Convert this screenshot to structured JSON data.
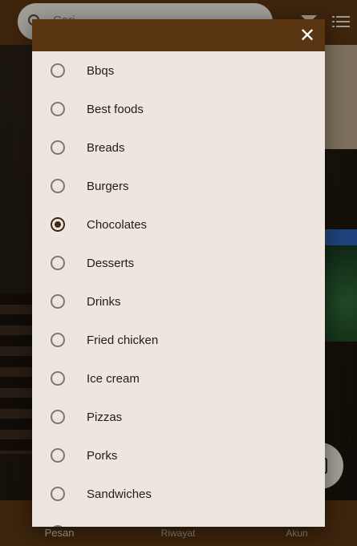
{
  "app": {
    "search": {
      "placeholder": "Cari..."
    },
    "bottom_nav": [
      {
        "label": "Pesan",
        "active": true
      },
      {
        "label": "Riwayat",
        "active": false
      },
      {
        "label": "Akun",
        "active": false
      }
    ]
  },
  "dialog": {
    "close_symbol": "✕",
    "selected": "Chocolates",
    "options": [
      {
        "label": "Bbqs",
        "checked": false
      },
      {
        "label": "Best foods",
        "checked": false
      },
      {
        "label": "Breads",
        "checked": false
      },
      {
        "label": "Burgers",
        "checked": false
      },
      {
        "label": "Chocolates",
        "checked": true
      },
      {
        "label": "Desserts",
        "checked": false
      },
      {
        "label": "Drinks",
        "checked": false
      },
      {
        "label": "Fried chicken",
        "checked": false
      },
      {
        "label": "Ice cream",
        "checked": false
      },
      {
        "label": "Pizzas",
        "checked": false
      },
      {
        "label": "Porks",
        "checked": false
      },
      {
        "label": "Sandwiches",
        "checked": false
      },
      {
        "label": "",
        "checked": false
      }
    ]
  },
  "colors": {
    "brand": "#5a3512",
    "dialog_bg": "#ece6df",
    "radio_checked": "#3e2717"
  },
  "icons": [
    "search-icon",
    "filter-icon",
    "list-icon",
    "close-icon",
    "cart-icon"
  ]
}
